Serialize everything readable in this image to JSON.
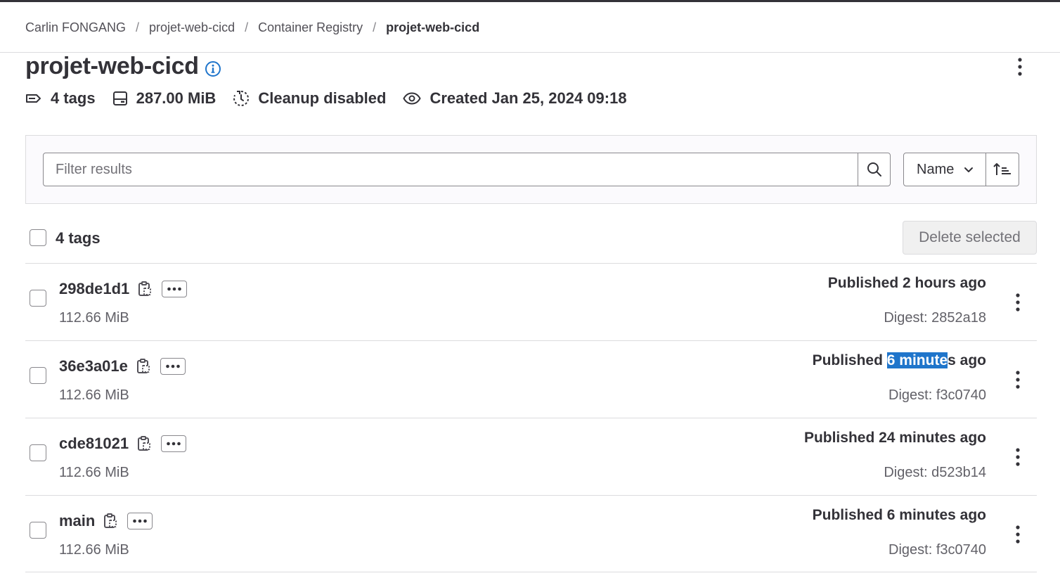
{
  "breadcrumb": {
    "items": [
      "Carlin FONGANG",
      "projet-web-cicd",
      "Container Registry",
      "projet-web-cicd"
    ],
    "separator": "/"
  },
  "page": {
    "title": "projet-web-cicd"
  },
  "meta": {
    "tags": "4 tags",
    "size": "287.00 MiB",
    "cleanup": "Cleanup disabled",
    "created": "Created Jan 25, 2024 09:18"
  },
  "filter": {
    "placeholder": "Filter results",
    "sort_label": "Name"
  },
  "list": {
    "count_label": "4 tags",
    "delete_selected": "Delete selected",
    "rows": [
      {
        "name": "298de1d1",
        "size": "112.66 MiB",
        "published": "Published 2 hours ago",
        "digest": "Digest: 2852a18"
      },
      {
        "name": "36e3a01e",
        "size": "112.66 MiB",
        "published_before": "Published ",
        "published_highlight": "6 minute",
        "published_after": "s ago",
        "digest": "Digest: f3c0740"
      },
      {
        "name": "cde81021",
        "size": "112.66 MiB",
        "published": "Published 24 minutes ago",
        "digest": "Digest: d523b14"
      },
      {
        "name": "main",
        "size": "112.66 MiB",
        "published": "Published 6 minutes ago",
        "digest": "Digest: f3c0740"
      }
    ]
  },
  "colors": {
    "text": "#333238",
    "muted": "#626168",
    "border": "#dcdcde",
    "info_blue": "#1f75cb",
    "selection_blue": "#1f75cb"
  }
}
